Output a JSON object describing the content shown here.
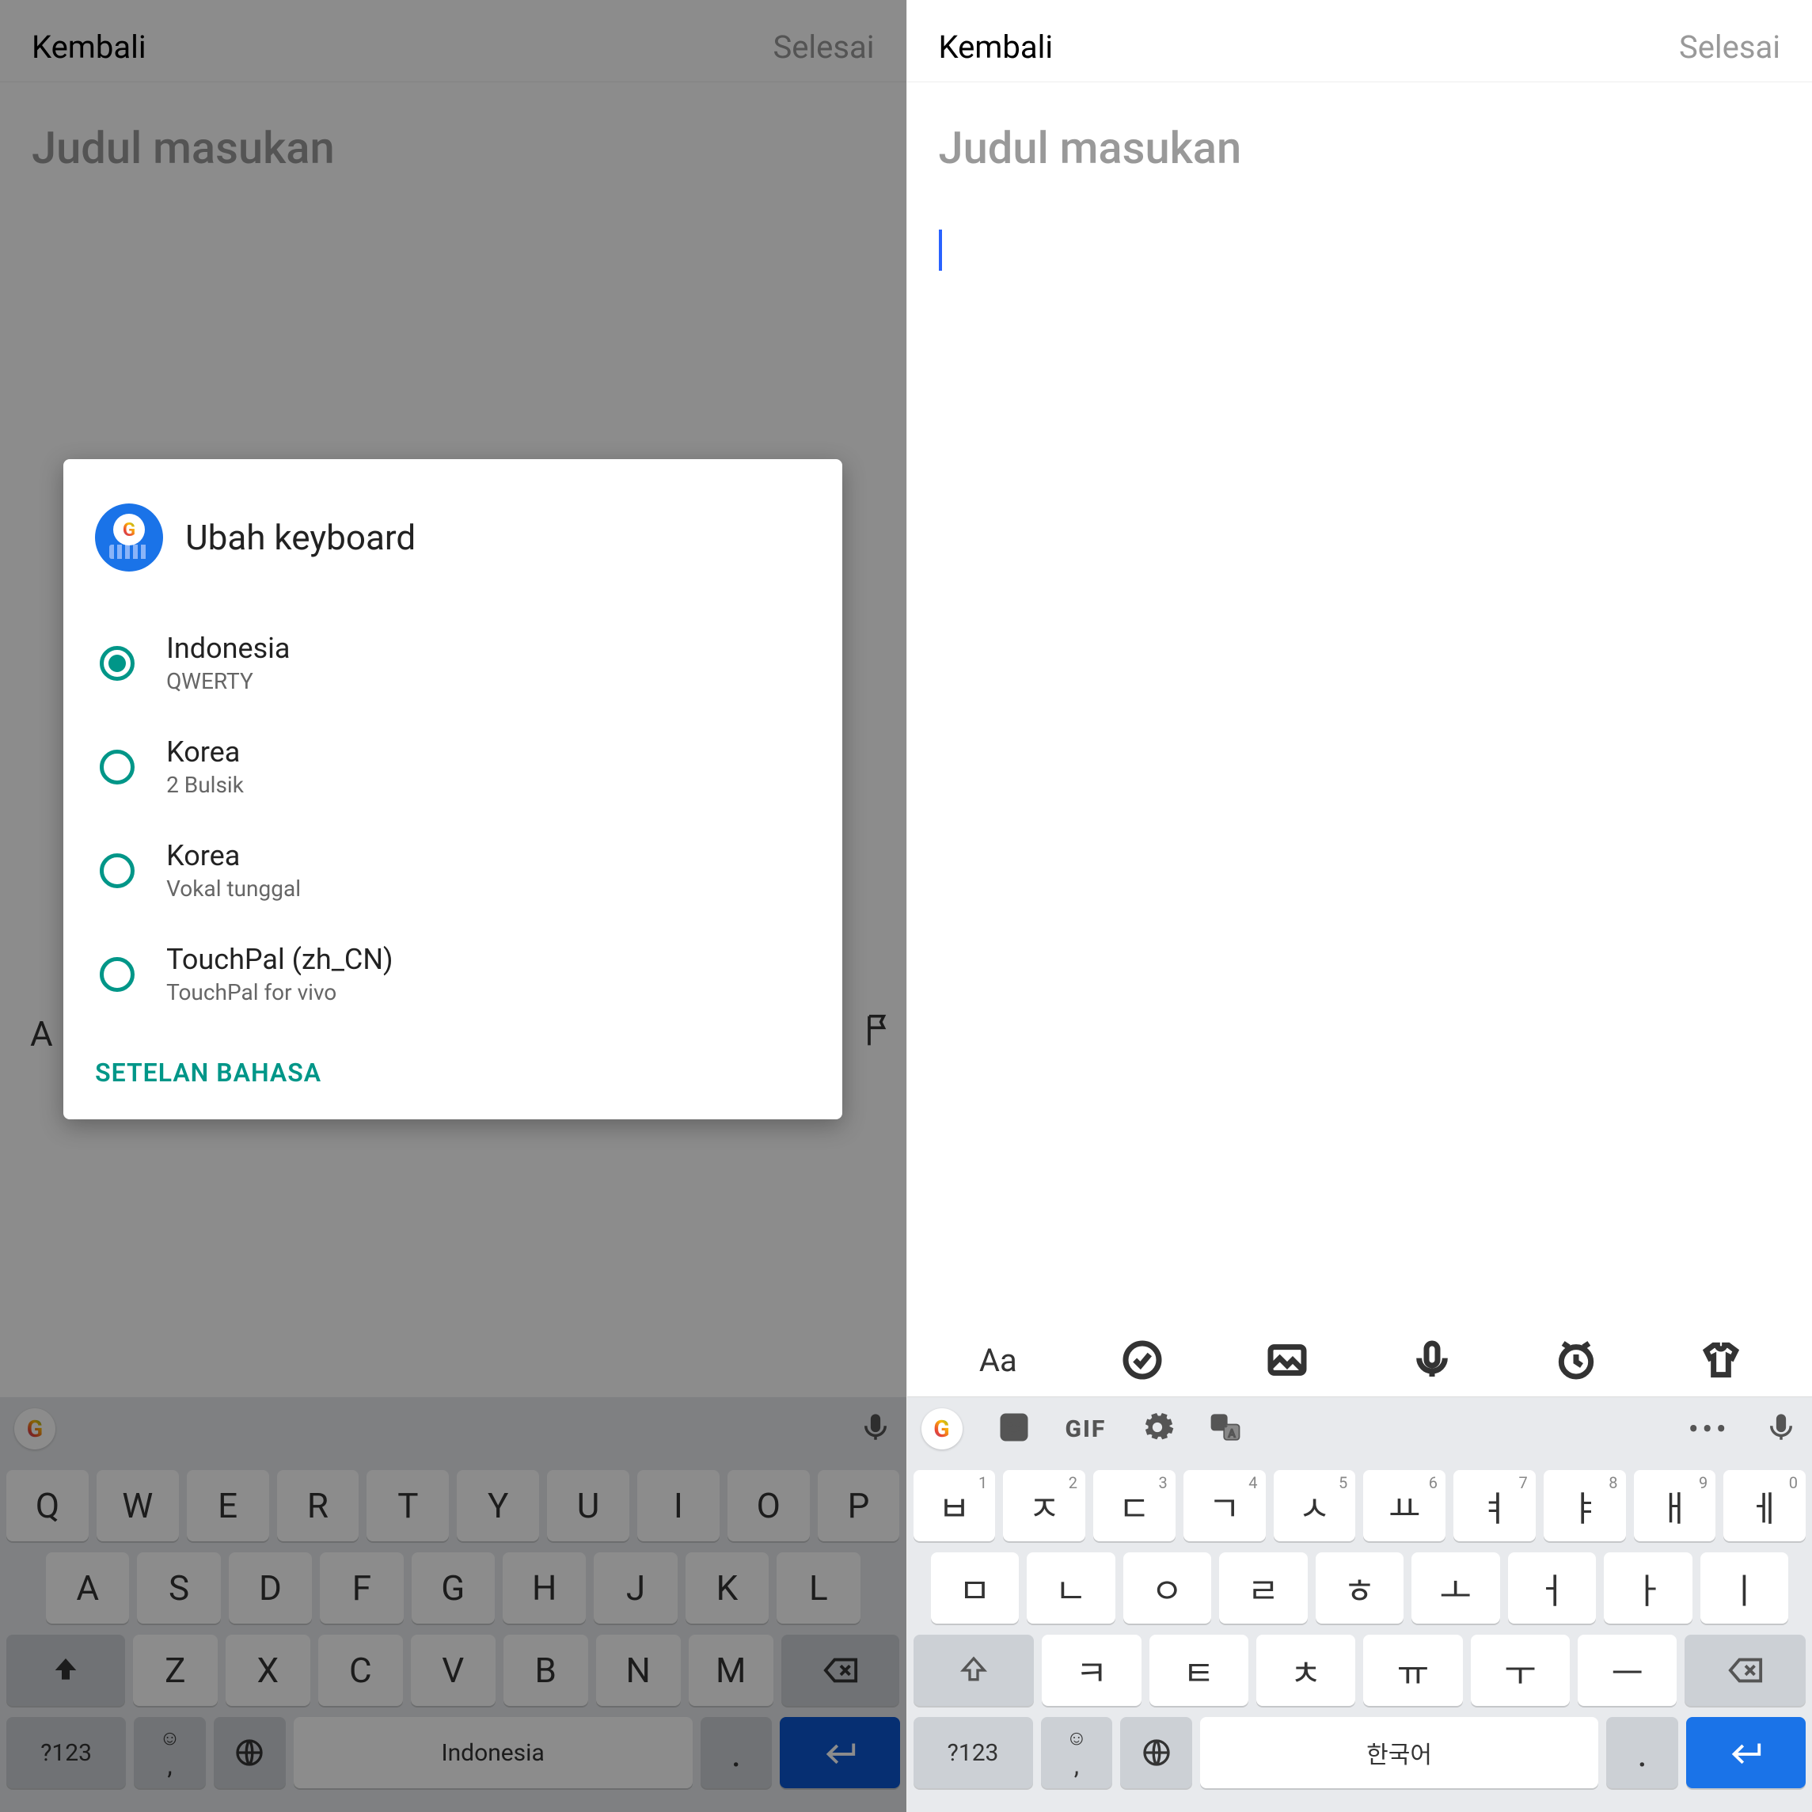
{
  "header": {
    "back": "Kembali",
    "done": "Selesai"
  },
  "title_placeholder": "Judul masukan",
  "dialog": {
    "title": "Ubah keyboard",
    "options": [
      {
        "title": "Indonesia",
        "sub": "QWERTY",
        "selected": true
      },
      {
        "title": "Korea",
        "sub": "2 Bulsik",
        "selected": false
      },
      {
        "title": "Korea",
        "sub": "Vokal tunggal",
        "selected": false
      },
      {
        "title": "TouchPal (zh_CN)",
        "sub": "TouchPal for vivo",
        "selected": false
      }
    ],
    "action": "SETELAN BAHASA"
  },
  "suggbar": {
    "gif": "GIF"
  },
  "toolbar": {
    "aa": "Aa"
  },
  "kbd_left": {
    "row1": [
      "Q",
      "W",
      "E",
      "R",
      "T",
      "Y",
      "U",
      "I",
      "O",
      "P"
    ],
    "row2": [
      "A",
      "S",
      "D",
      "F",
      "G",
      "H",
      "J",
      "K",
      "L"
    ],
    "row3": [
      "Z",
      "X",
      "C",
      "V",
      "B",
      "N",
      "M"
    ],
    "num": "?123",
    "emoji": "☺",
    "comma": ",",
    "space": "Indonesia",
    "period": "."
  },
  "kbd_right": {
    "row1": [
      "ㅂ",
      "ㅈ",
      "ㄷ",
      "ㄱ",
      "ㅅ",
      "ㅛ",
      "ㅕ",
      "ㅑ",
      "ㅐ",
      "ㅔ"
    ],
    "row1_sup": [
      "1",
      "2",
      "3",
      "4",
      "5",
      "6",
      "7",
      "8",
      "9",
      "0"
    ],
    "row2": [
      "ㅁ",
      "ㄴ",
      "ㅇ",
      "ㄹ",
      "ㅎ",
      "ㅗ",
      "ㅓ",
      "ㅏ",
      "ㅣ"
    ],
    "row3": [
      "ㅋ",
      "ㅌ",
      "ㅊ",
      "ㅠ",
      "ㅜ",
      "ㅡ"
    ],
    "num": "?123",
    "emoji": "☺",
    "comma": ",",
    "space": "한국어",
    "period": "."
  }
}
